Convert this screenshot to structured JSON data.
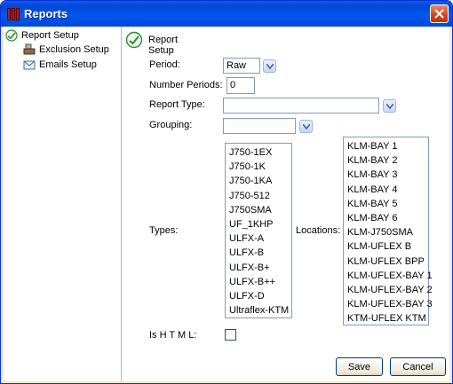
{
  "window": {
    "title": "Reports"
  },
  "nav": {
    "items": [
      {
        "label": "Report Setup",
        "icon": "report-setup-icon"
      },
      {
        "label": "Exclusion Setup",
        "icon": "exclusion-setup-icon"
      },
      {
        "label": "Emails Setup",
        "icon": "emails-setup-icon"
      }
    ]
  },
  "main": {
    "heading": "Report Setup",
    "period": {
      "label": "Period:",
      "value": "Raw"
    },
    "number_periods": {
      "label": "Number Periods:",
      "value": "0"
    },
    "report_type": {
      "label": "Report Type:",
      "value": ""
    },
    "grouping": {
      "label": "Grouping:",
      "value": ""
    },
    "types": {
      "label": "Types:",
      "items": [
        "J750-1EX",
        "J750-1K",
        "J750-1KA",
        "J750-512",
        "J750SMA",
        "UF_1KHP",
        "ULFX-A",
        "ULFX-B",
        "ULFX-B+",
        "ULFX-B++",
        "ULFX-D",
        "Ultraflex-KTM"
      ]
    },
    "locations": {
      "label": "Locations:",
      "items": [
        "KLM-BAY 1",
        "KLM-BAY 2",
        "KLM-BAY 3",
        "KLM-BAY 4",
        "KLM-BAY 5",
        "KLM-BAY 6",
        "KLM-J750SMA",
        "KLM-UFLEX B",
        "KLM-UFLEX BPP",
        "KLM-UFLEX-BAY 1",
        "KLM-UFLEX-BAY 2",
        "KLM-UFLEX-BAY 3",
        "KTM-UFLEX KTM"
      ]
    },
    "is_html": {
      "label": "Is H T M L:",
      "checked": false
    },
    "save_label": "Save",
    "cancel_label": "Cancel"
  },
  "colors": {
    "titlebar": "#0054e3",
    "accent_green": "#2e8b2e",
    "border": "#7f9db9"
  }
}
